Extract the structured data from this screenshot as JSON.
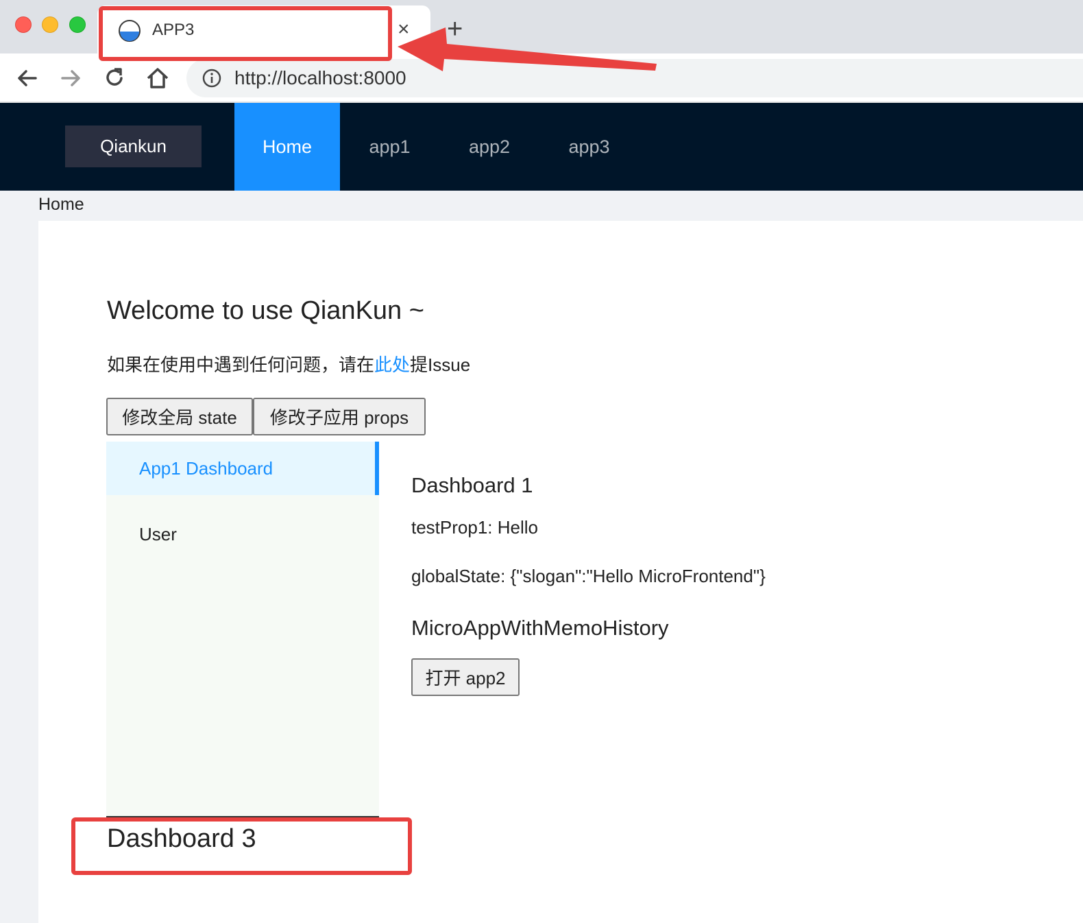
{
  "browser": {
    "tab_title": "APP3",
    "close_glyph": "×",
    "new_tab_glyph": "+",
    "url": "http://localhost:8000"
  },
  "header": {
    "logo": "Qiankun",
    "nav": [
      {
        "label": "Home",
        "active": true
      },
      {
        "label": "app1",
        "active": false
      },
      {
        "label": "app2",
        "active": false
      },
      {
        "label": "app3",
        "active": false
      }
    ]
  },
  "breadcrumb": "Home",
  "main": {
    "welcome": "Welcome to use QianKun ~",
    "notice_before": "如果在使用中遇到任何问题，请在",
    "notice_link": "此处",
    "notice_after": "提Issue",
    "buttons": {
      "change_state": "修改全局 state",
      "change_props": "修改子应用 props"
    }
  },
  "app1": {
    "menu": [
      {
        "label": "App1 Dashboard",
        "selected": true
      },
      {
        "label": "User",
        "selected": false
      }
    ],
    "dashboard_title": "Dashboard 1",
    "test_prop": "testProp1: Hello",
    "global_state": "globalState: {\"slogan\":\"Hello MicroFrontend\"}",
    "micro_title": "MicroAppWithMemoHistory",
    "open_app2": "打开 app2"
  },
  "app3": {
    "dashboard_title": "Dashboard 3"
  },
  "colors": {
    "header_bg": "#001529",
    "primary": "#1890ff",
    "annotation": "#e8413f"
  },
  "icons": [
    "favicon-icon",
    "close-icon",
    "plus-icon",
    "back-icon",
    "forward-icon",
    "reload-icon",
    "home-icon",
    "info-icon"
  ]
}
